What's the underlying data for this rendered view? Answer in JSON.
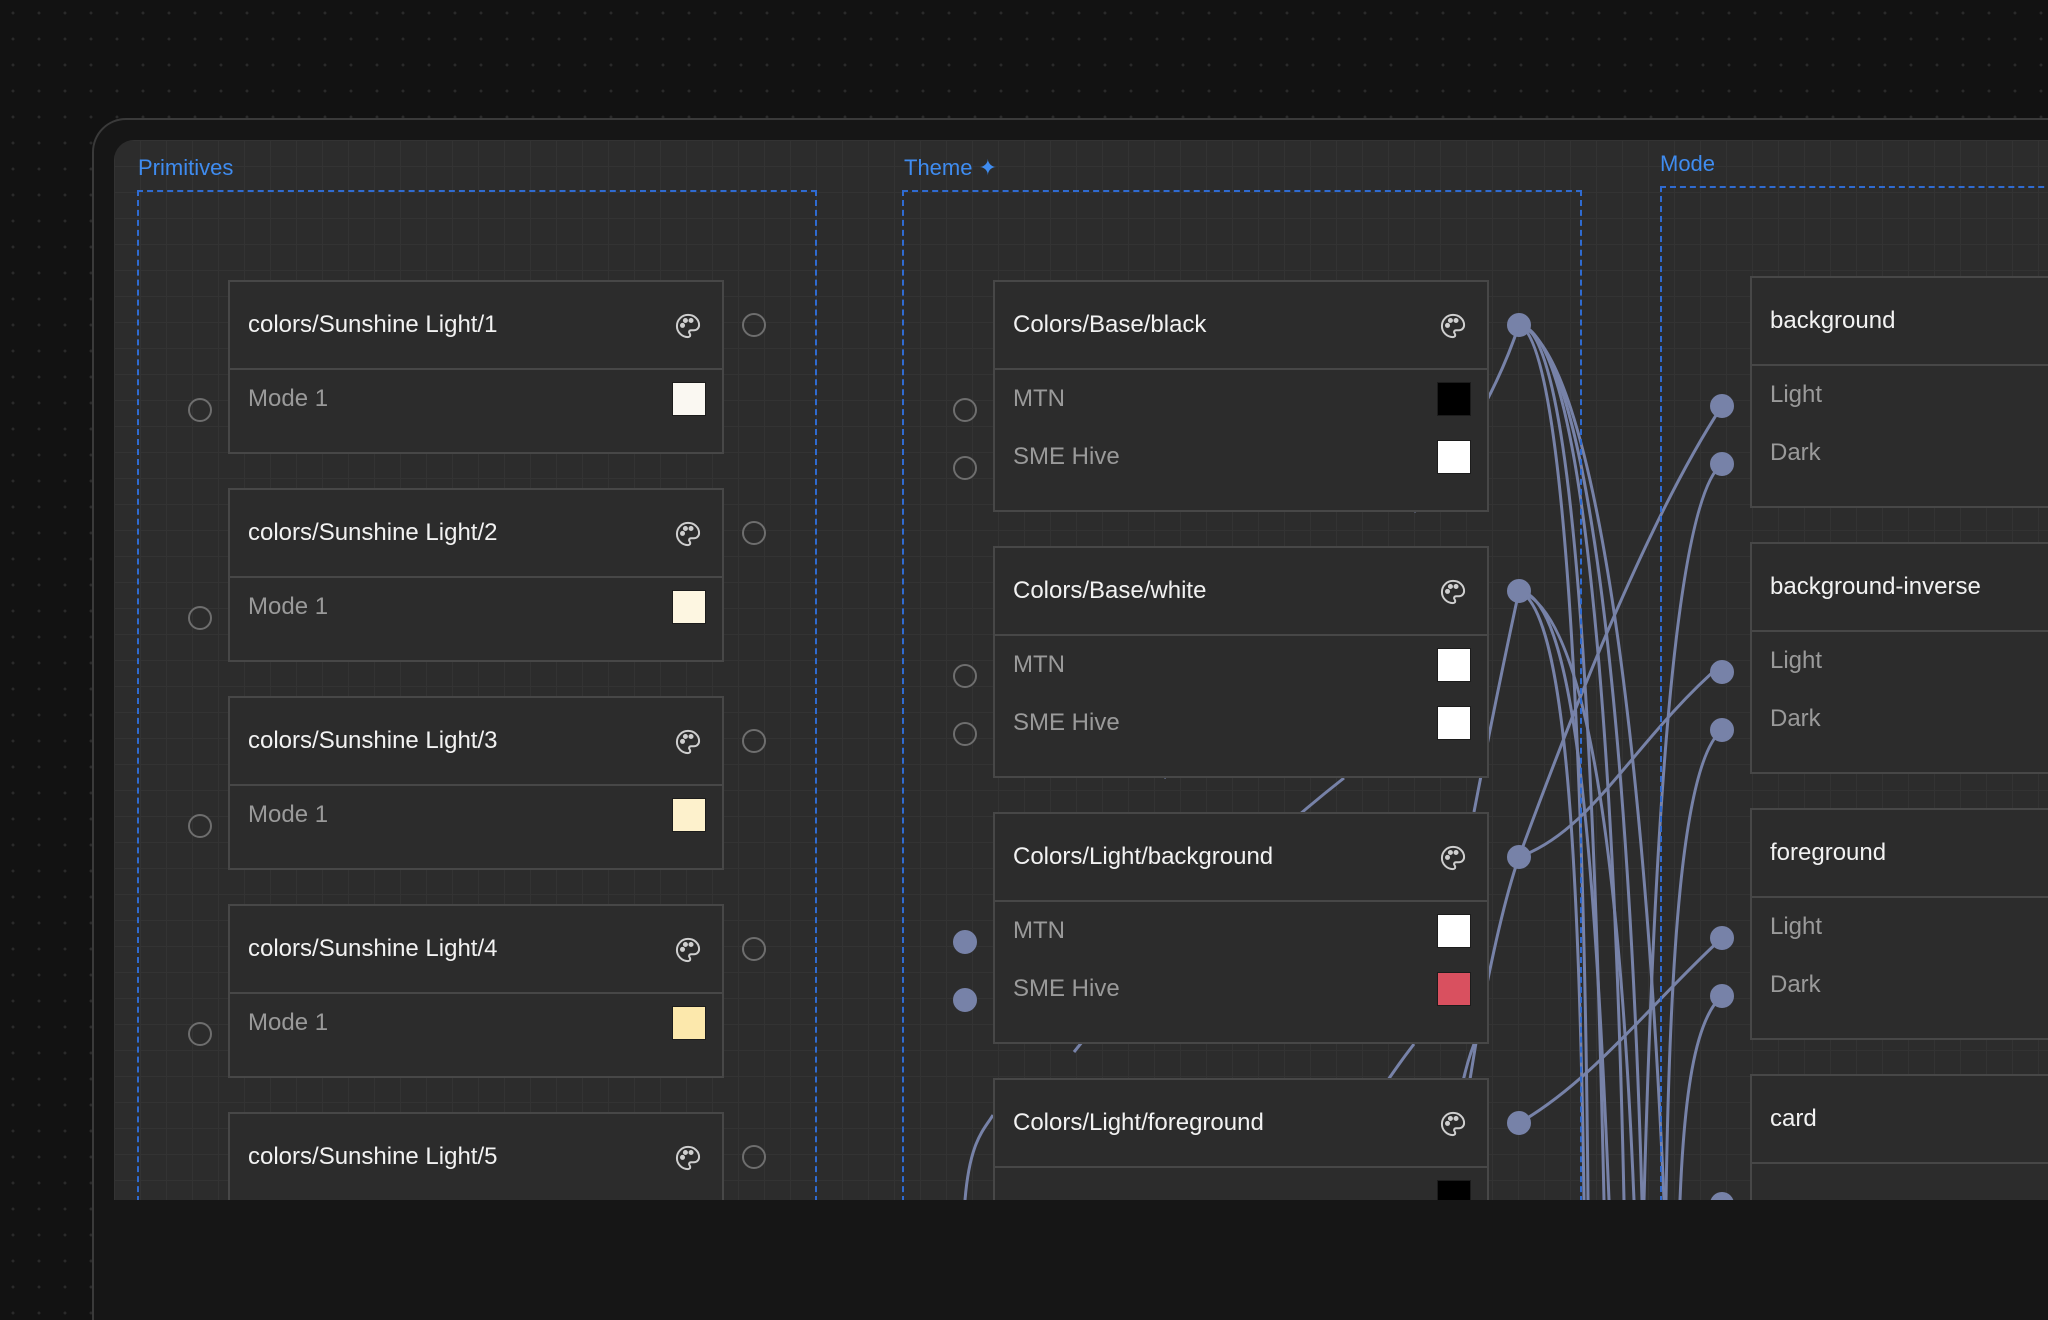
{
  "colors": {
    "accent": "#3f8cf0",
    "wire": "#7782a8",
    "canvas": "#2c2c2c",
    "card_border": "#474747"
  },
  "groups": {
    "primitives": {
      "label": "Primitives"
    },
    "theme": {
      "label": "Theme ✦"
    },
    "mode": {
      "label": "Mode"
    }
  },
  "primitives": [
    {
      "title": "colors/Sunshine  Light/1",
      "icon": "palette-icon",
      "rows": [
        {
          "label": "Mode 1",
          "swatch": "#faf8f2"
        }
      ]
    },
    {
      "title": "colors/Sunshine  Light/2",
      "icon": "palette-icon",
      "rows": [
        {
          "label": "Mode 1",
          "swatch": "#fdf6e1"
        }
      ]
    },
    {
      "title": "colors/Sunshine  Light/3",
      "icon": "palette-icon",
      "rows": [
        {
          "label": "Mode 1",
          "swatch": "#fdf1cc"
        }
      ]
    },
    {
      "title": "colors/Sunshine  Light/4",
      "icon": "palette-icon",
      "rows": [
        {
          "label": "Mode 1",
          "swatch": "#fce8ac"
        }
      ]
    },
    {
      "title": "colors/Sunshine  Light/5",
      "icon": "palette-icon",
      "rows": []
    }
  ],
  "theme": [
    {
      "title": "Colors/Base/black",
      "icon": "palette-icon",
      "rows": [
        {
          "label": "MTN",
          "swatch": "#000000"
        },
        {
          "label": "SME Hive",
          "swatch": "#ffffff"
        }
      ]
    },
    {
      "title": "Colors/Base/white",
      "icon": "palette-icon",
      "rows": [
        {
          "label": "MTN",
          "swatch": "#ffffff"
        },
        {
          "label": "SME Hive",
          "swatch": "#ffffff"
        }
      ]
    },
    {
      "title": "Colors/Light/background",
      "icon": "palette-icon",
      "rows": [
        {
          "label": "MTN",
          "swatch": "#ffffff"
        },
        {
          "label": "SME Hive",
          "swatch": "#d9505f"
        }
      ]
    },
    {
      "title": "Colors/Light/foreground",
      "icon": "palette-icon",
      "rows": []
    }
  ],
  "mode": [
    {
      "title": "background",
      "rows": [
        {
          "label": "Light"
        },
        {
          "label": "Dark"
        }
      ]
    },
    {
      "title": "background-inverse",
      "rows": [
        {
          "label": "Light"
        },
        {
          "label": "Dark"
        }
      ]
    },
    {
      "title": "foreground",
      "rows": [
        {
          "label": "Light"
        },
        {
          "label": "Dark"
        }
      ]
    },
    {
      "title": "card",
      "rows": []
    }
  ]
}
